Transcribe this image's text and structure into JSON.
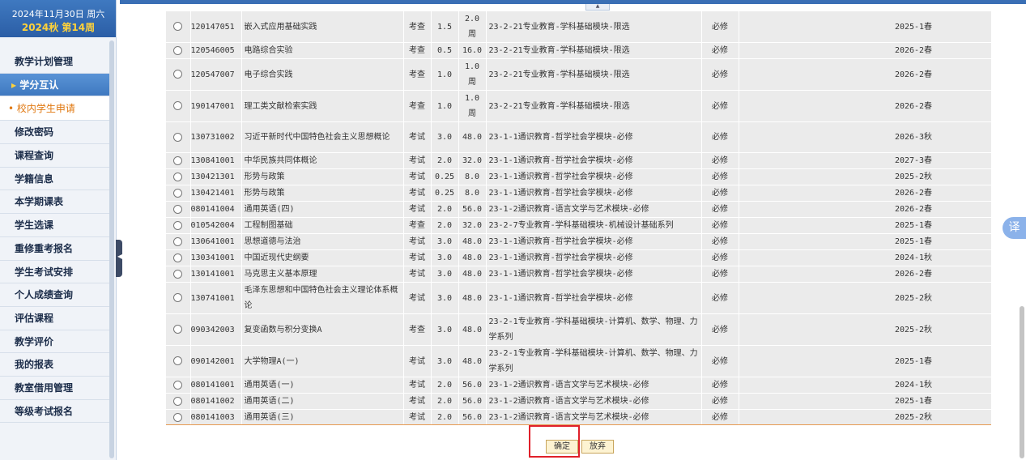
{
  "sidebar": {
    "date_line1": "2024年11月30日  周六",
    "date_line2": "2024秋 第14周",
    "items": [
      {
        "label": "教学计划管理",
        "state": "normal"
      },
      {
        "label": "学分互认",
        "state": "active"
      },
      {
        "label": "校内学生申请",
        "state": "sub"
      },
      {
        "label": "修改密码",
        "state": "normal"
      },
      {
        "label": "课程查询",
        "state": "normal"
      },
      {
        "label": "学籍信息",
        "state": "normal"
      },
      {
        "label": "本学期课表",
        "state": "normal"
      },
      {
        "label": "学生选课",
        "state": "normal"
      },
      {
        "label": "重修重考报名",
        "state": "normal"
      },
      {
        "label": "学生考试安排",
        "state": "normal"
      },
      {
        "label": "个人成绩查询",
        "state": "normal"
      },
      {
        "label": "评估课程",
        "state": "normal"
      },
      {
        "label": "教学评价",
        "state": "normal"
      },
      {
        "label": "我的报表",
        "state": "normal"
      },
      {
        "label": "教室借用管理",
        "state": "normal"
      },
      {
        "label": "等级考试报名",
        "state": "normal"
      }
    ]
  },
  "table": {
    "rows": [
      {
        "code": "120147051",
        "name": "嵌入式应用基础实践",
        "assess": "考查",
        "credit": "1.5",
        "hours": "2.0 周",
        "program": "23-2-21专业教育-学科基础模块-限选",
        "type": "必修",
        "term": "2025-1春",
        "tall": true
      },
      {
        "code": "120546005",
        "name": "电路综合实验",
        "assess": "考查",
        "credit": "0.5",
        "hours": "16.0",
        "program": "23-2-21专业教育-学科基础模块-限选",
        "type": "必修",
        "term": "2026-2春",
        "tall": false
      },
      {
        "code": "120547007",
        "name": "电子综合实践",
        "assess": "考查",
        "credit": "1.0",
        "hours": "1.0 周",
        "program": "23-2-21专业教育-学科基础模块-限选",
        "type": "必修",
        "term": "2026-2春",
        "tall": true
      },
      {
        "code": "190147001",
        "name": "理工类文献检索实践",
        "assess": "考查",
        "credit": "1.0",
        "hours": "1.0 周",
        "program": "23-2-21专业教育-学科基础模块-限选",
        "type": "必修",
        "term": "2026-2春",
        "tall": true
      },
      {
        "code": "130731002",
        "name": "习近平新时代中国特色社会主义思想概论",
        "assess": "考试",
        "credit": "3.0",
        "hours": "48.0",
        "program": "23-1-1通识教育-哲学社会学模块-必修",
        "type": "必修",
        "term": "2026-3秋",
        "tall": true
      },
      {
        "code": "130841001",
        "name": "中华民族共同体概论",
        "assess": "考试",
        "credit": "2.0",
        "hours": "32.0",
        "program": "23-1-1通识教育-哲学社会学模块-必修",
        "type": "必修",
        "term": "2027-3春",
        "tall": false
      },
      {
        "code": "130421301",
        "name": "形势与政策",
        "assess": "考试",
        "credit": "0.25",
        "hours": "8.0",
        "program": "23-1-1通识教育-哲学社会学模块-必修",
        "type": "必修",
        "term": "2025-2秋",
        "tall": false
      },
      {
        "code": "130421401",
        "name": "形势与政策",
        "assess": "考试",
        "credit": "0.25",
        "hours": "8.0",
        "program": "23-1-1通识教育-哲学社会学模块-必修",
        "type": "必修",
        "term": "2026-2春",
        "tall": false
      },
      {
        "code": "080141004",
        "name": "通用英语(四)",
        "assess": "考试",
        "credit": "2.0",
        "hours": "56.0",
        "program": "23-1-2通识教育-语言文学与艺术模块-必修",
        "type": "必修",
        "term": "2026-2春",
        "tall": false
      },
      {
        "code": "010542004",
        "name": "工程制图基础",
        "assess": "考查",
        "credit": "2.0",
        "hours": "32.0",
        "program": "23-2-7专业教育-学科基础模块-机械设计基础系列",
        "type": "必修",
        "term": "2025-1春",
        "tall": false
      },
      {
        "code": "130641001",
        "name": "思想道德与法治",
        "assess": "考试",
        "credit": "3.0",
        "hours": "48.0",
        "program": "23-1-1通识教育-哲学社会学模块-必修",
        "type": "必修",
        "term": "2025-1春",
        "tall": false
      },
      {
        "code": "130341001",
        "name": "中国近现代史纲要",
        "assess": "考试",
        "credit": "3.0",
        "hours": "48.0",
        "program": "23-1-1通识教育-哲学社会学模块-必修",
        "type": "必修",
        "term": "2024-1秋",
        "tall": false
      },
      {
        "code": "130141001",
        "name": "马克思主义基本原理",
        "assess": "考试",
        "credit": "3.0",
        "hours": "48.0",
        "program": "23-1-1通识教育-哲学社会学模块-必修",
        "type": "必修",
        "term": "2026-2春",
        "tall": false
      },
      {
        "code": "130741001",
        "name": "毛泽东思想和中国特色社会主义理论体系概论",
        "assess": "考试",
        "credit": "3.0",
        "hours": "48.0",
        "program": "23-1-1通识教育-哲学社会学模块-必修",
        "type": "必修",
        "term": "2025-2秋",
        "tall": true
      },
      {
        "code": "090342003",
        "name": "复变函数与积分变换A",
        "assess": "考查",
        "credit": "3.0",
        "hours": "48.0",
        "program": "23-2-1专业教育-学科基础模块-计算机、数学、物理、力学系列",
        "type": "必修",
        "term": "2025-2秋",
        "tall": true
      },
      {
        "code": "090142001",
        "name": "大学物理A(一)",
        "assess": "考试",
        "credit": "3.0",
        "hours": "48.0",
        "program": "23-2-1专业教育-学科基础模块-计算机、数学、物理、力学系列",
        "type": "必修",
        "term": "2025-1春",
        "tall": true
      },
      {
        "code": "080141001",
        "name": "通用英语(一)",
        "assess": "考试",
        "credit": "2.0",
        "hours": "56.0",
        "program": "23-1-2通识教育-语言文学与艺术模块-必修",
        "type": "必修",
        "term": "2024-1秋",
        "tall": false
      },
      {
        "code": "080141002",
        "name": "通用英语(二)",
        "assess": "考试",
        "credit": "2.0",
        "hours": "56.0",
        "program": "23-1-2通识教育-语言文学与艺术模块-必修",
        "type": "必修",
        "term": "2025-1春",
        "tall": false
      },
      {
        "code": "080141003",
        "name": "通用英语(三)",
        "assess": "考试",
        "credit": "2.0",
        "hours": "56.0",
        "program": "23-1-2通识教育-语言文学与艺术模块-必修",
        "type": "必修",
        "term": "2025-2秋",
        "tall": false
      }
    ]
  },
  "buttons": {
    "confirm_label": "确定",
    "cancel_label": "放弃"
  },
  "translate": {
    "label": "译"
  },
  "top_tab": {
    "glyph": "▲"
  },
  "collapse": {
    "glyph": "◀"
  }
}
